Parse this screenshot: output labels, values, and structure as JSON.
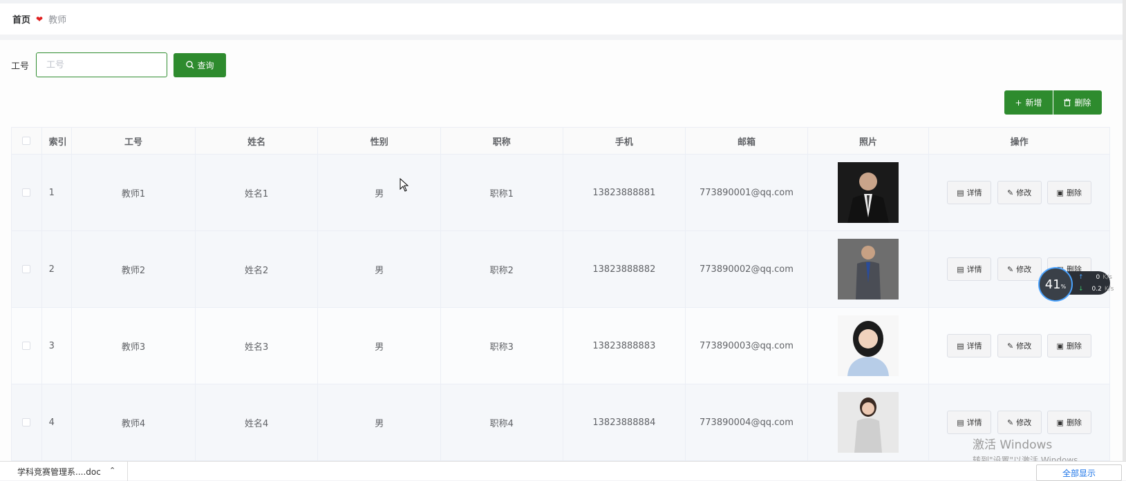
{
  "breadcrumb": {
    "home": "首页",
    "separator_icon": "heart-icon",
    "current": "教师"
  },
  "search": {
    "label": "工号",
    "placeholder": "工号",
    "value": "",
    "query_label": "查询"
  },
  "toolbar": {
    "add_label": "新增",
    "delete_label": "删除"
  },
  "table": {
    "headers": {
      "index": "索引",
      "job_no": "工号",
      "name": "姓名",
      "gender": "性别",
      "title": "职称",
      "phone": "手机",
      "email": "邮箱",
      "photo": "照片",
      "ops": "操作"
    },
    "rows": [
      {
        "index": "1",
        "job_no": "教师1",
        "name": "姓名1",
        "gender": "男",
        "title": "职称1",
        "phone": "13823888881",
        "email": "773890001@qq.com"
      },
      {
        "index": "2",
        "job_no": "教师2",
        "name": "姓名2",
        "gender": "男",
        "title": "职称2",
        "phone": "13823888882",
        "email": "773890002@qq.com"
      },
      {
        "index": "3",
        "job_no": "教师3",
        "name": "姓名3",
        "gender": "男",
        "title": "职称3",
        "phone": "13823888883",
        "email": "773890003@qq.com"
      },
      {
        "index": "4",
        "job_no": "教师4",
        "name": "姓名4",
        "gender": "男",
        "title": "职称4",
        "phone": "13823888884",
        "email": "773890004@qq.com"
      }
    ],
    "ops": {
      "detail": "详情",
      "edit": "修改",
      "delete": "删除"
    }
  },
  "net_widget": {
    "percent": "41",
    "unit": "%",
    "up": "0",
    "down": "0.2",
    "speed_unit": "K/s"
  },
  "watermark": {
    "line1": "激活 Windows",
    "line2": "转到\"设置\"以激活 Windows。"
  },
  "download_bar": {
    "file": "学科竞赛管理系....doc",
    "show_all": "全部显示"
  },
  "colors": {
    "primary": "#2e8b2e",
    "heart": "#e02020"
  }
}
